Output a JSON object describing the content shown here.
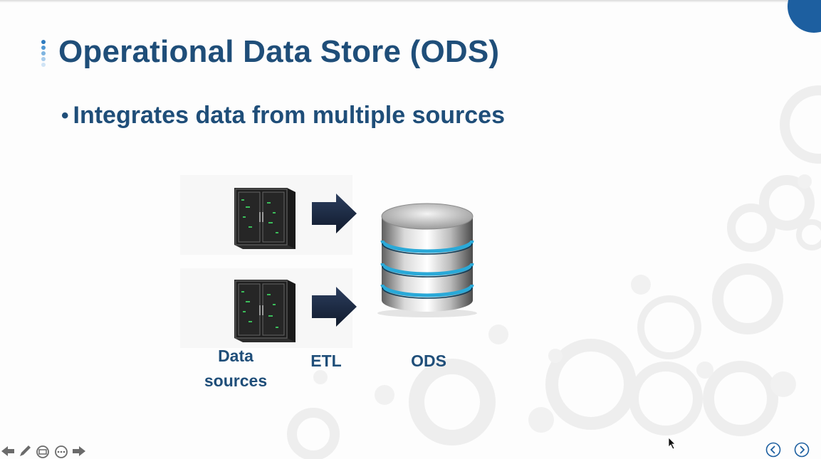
{
  "slide": {
    "title": "Operational Data Store (ODS)",
    "bullet": "Integrates data from multiple sources"
  },
  "diagram": {
    "labels": {
      "data_sources_line1": "Data",
      "data_sources_line2": "sources",
      "etl": "ETL",
      "ods": "ODS"
    },
    "icons": [
      "server-icon",
      "arrow-right-icon",
      "database-icon"
    ]
  },
  "controls": {
    "left_icons": [
      "arrow-left-icon",
      "pen-icon",
      "slides-icon",
      "more-icon",
      "arrow-right-icon"
    ],
    "right_icons": [
      "previous-slide-icon",
      "next-slide-icon"
    ]
  },
  "colors": {
    "title": "#1f4e79",
    "accent": "#1d5fa0",
    "arrow": "#1b2a45",
    "db_ring": "#2aa9d8"
  }
}
